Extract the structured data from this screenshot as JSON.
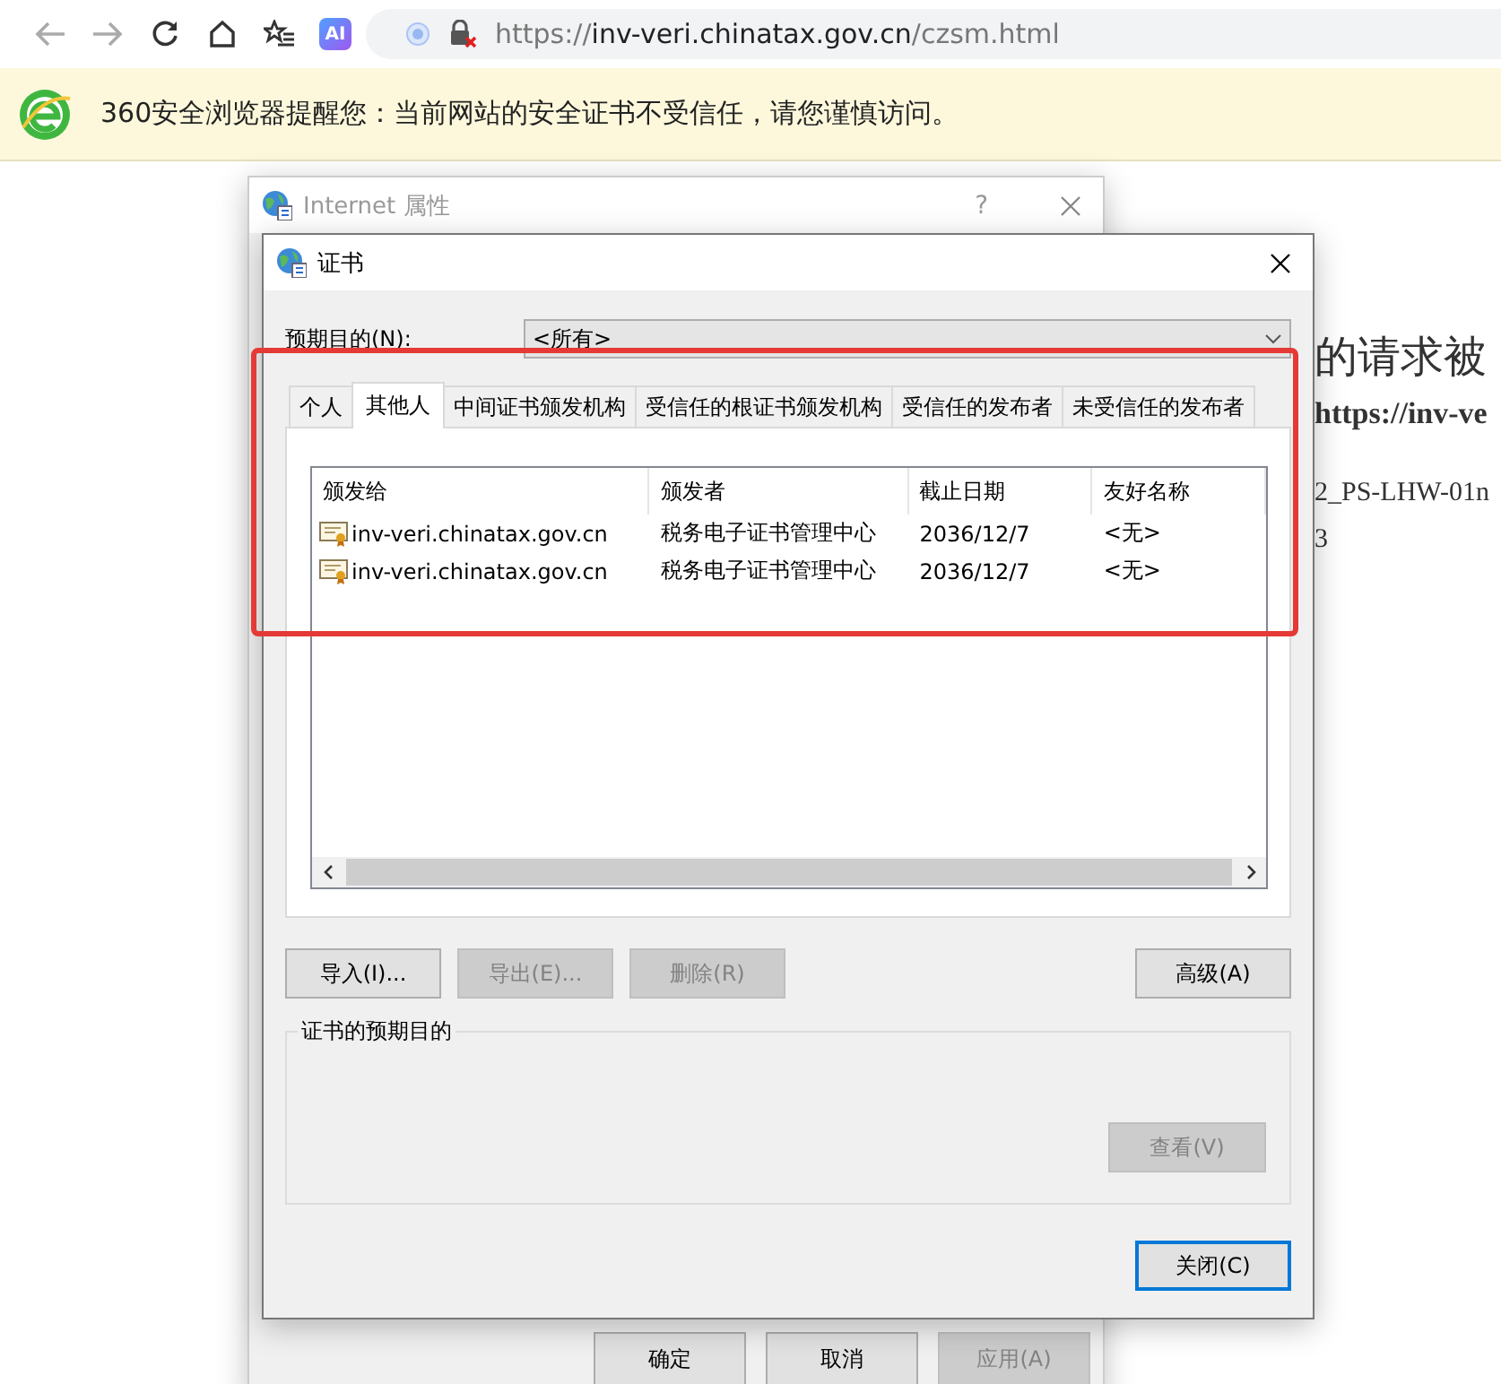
{
  "browser": {
    "ai_button": {
      "label": "AI"
    },
    "address_bar": {
      "scheme": "https://",
      "host": "inv-veri.chinatax.gov.cn",
      "path": "/czsm.html"
    }
  },
  "warning_bar": {
    "text": "360安全浏览器提醒您：当前网站的安全证书不受信任，请您谨慎访问。"
  },
  "page_text": [
    {
      "text": "的请求被",
      "kind": "heading"
    },
    {
      "text": "https://inv-ve",
      "kind": "bold"
    },
    {
      "text": "2_PS-LHW-01n",
      "kind": "plain"
    },
    {
      "text": "3",
      "kind": "plain"
    }
  ],
  "back_dialog": {
    "title": "Internet 属性",
    "help": "?",
    "buttons": [
      {
        "label": "确定",
        "disabled": false
      },
      {
        "label": "取消",
        "disabled": false
      },
      {
        "label": "应用(A)",
        "disabled": true
      }
    ]
  },
  "cert_dialog": {
    "title": "证书",
    "purpose": {
      "label": "预期目的(N):",
      "value": "<所有>"
    },
    "tabs": [
      {
        "label": "个人",
        "selected": false
      },
      {
        "label": "其他人",
        "selected": true
      },
      {
        "label": "中间证书颁发机构",
        "selected": false
      },
      {
        "label": "受信任的根证书颁发机构",
        "selected": false
      },
      {
        "label": "受信任的发布者",
        "selected": false
      },
      {
        "label": "未受信任的发布者",
        "selected": false
      }
    ],
    "list": {
      "columns": [
        "颁发给",
        "颁发者",
        "截止日期",
        "友好名称"
      ],
      "rows": [
        {
          "cells": [
            "inv-veri.chinatax.gov.cn",
            "税务电子证书管理中心",
            "2036/12/7",
            "<无>"
          ]
        },
        {
          "cells": [
            "inv-veri.chinatax.gov.cn",
            "税务电子证书管理中心",
            "2036/12/7",
            "<无>"
          ]
        }
      ]
    },
    "buttons": [
      {
        "label": "导入(I)...",
        "disabled": false
      },
      {
        "label": "导出(E)...",
        "disabled": true
      },
      {
        "label": "删除(R)",
        "disabled": true
      },
      {
        "label": "高级(A)",
        "disabled": false
      }
    ],
    "purposes_group": {
      "title": "证书的预期目的",
      "view_button": {
        "label": "查看(V)",
        "disabled": true
      }
    },
    "close_button": {
      "label": "关闭(C)",
      "default": true
    }
  }
}
